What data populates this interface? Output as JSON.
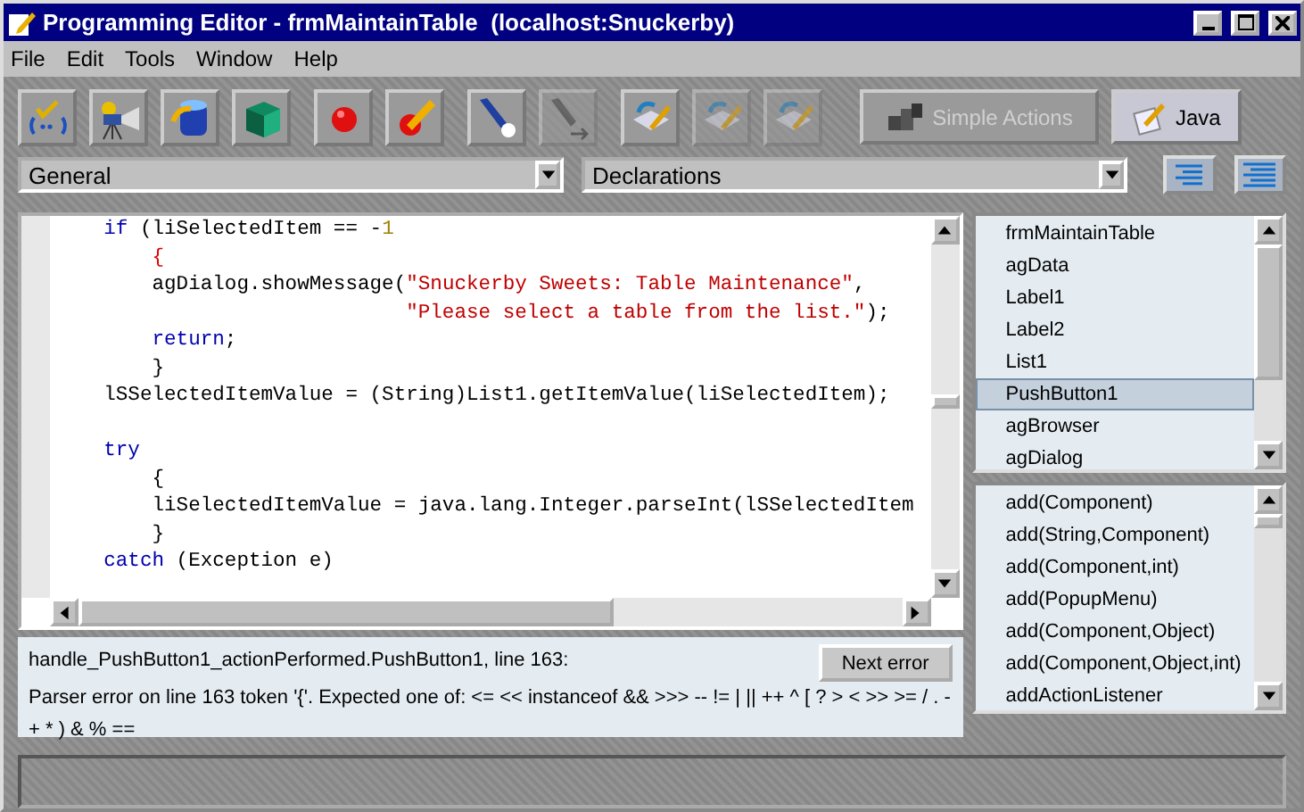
{
  "window": {
    "title": "Programming Editor - frmMaintainTable  (localhost:Snuckerby)"
  },
  "menu": [
    "File",
    "Edit",
    "Tools",
    "Window",
    "Help"
  ],
  "toolbar": [
    {
      "kind": "check",
      "disabled": false
    },
    {
      "kind": "camera",
      "disabled": false
    },
    {
      "kind": "database",
      "disabled": false
    },
    {
      "kind": "cube",
      "disabled": false
    },
    {
      "kind": "ball",
      "disabled": false
    },
    {
      "kind": "pencil-ball",
      "disabled": false
    },
    {
      "kind": "flashlight",
      "disabled": false
    },
    {
      "kind": "flashlight-arrow",
      "disabled": true
    },
    {
      "kind": "undo",
      "disabled": false
    },
    {
      "kind": "undo",
      "disabled": true
    },
    {
      "kind": "undo",
      "disabled": true
    }
  ],
  "mode_buttons": [
    {
      "label": "Simple Actions",
      "disabled": true,
      "selected": false
    },
    {
      "label": "Java",
      "disabled": false,
      "selected": true
    }
  ],
  "object_dropdown": {
    "value": "General"
  },
  "procedure_dropdown": {
    "value": "Declarations"
  },
  "view_buttons": [
    {
      "kind": "short-lines"
    },
    {
      "kind": "long-lines"
    }
  ],
  "code": [
    [
      {
        "kind": "keyword",
        "text": "    if"
      },
      {
        "kind": "plain",
        "text": " (liSelectedItem == -"
      },
      {
        "kind": "number",
        "text": "1"
      }
    ],
    [
      {
        "kind": "brace",
        "text": "        {"
      }
    ],
    [
      {
        "kind": "plain",
        "text": "        agDialog.showMessage("
      },
      {
        "kind": "string",
        "text": "\"Snuckerby Sweets: Table Maintenance\""
      },
      {
        "kind": "plain",
        "text": ","
      }
    ],
    [
      {
        "kind": "string",
        "text": "                             \"Please select a table from the list.\""
      },
      {
        "kind": "plain",
        "text": ");"
      }
    ],
    [
      {
        "kind": "keyword",
        "text": "        return"
      },
      {
        "kind": "plain",
        "text": ";"
      }
    ],
    [
      {
        "kind": "plain",
        "text": "        }"
      }
    ],
    [
      {
        "kind": "plain",
        "text": "    lSSelectedItemValue = (String)List1.getItemValue(liSelectedItem);"
      }
    ],
    [
      {
        "kind": "keyword",
        "text": "    try",
        "gap_before": true
      }
    ],
    [
      {
        "kind": "plain",
        "text": "        {"
      }
    ],
    [
      {
        "kind": "plain",
        "text": "        liSelectedItemValue = java.lang.Integer.parseInt(lSSelectedItem"
      }
    ],
    [
      {
        "kind": "plain",
        "text": "        }"
      }
    ],
    [
      {
        "kind": "keyword",
        "text": "    catch"
      },
      {
        "kind": "plain",
        "text": " (Exception e)"
      }
    ]
  ],
  "objects": [
    {
      "label": "frmMaintainTable",
      "selected": false
    },
    {
      "label": "agData",
      "selected": false
    },
    {
      "label": "Label1",
      "selected": false
    },
    {
      "label": "Label2",
      "selected": false
    },
    {
      "label": "List1",
      "selected": false
    },
    {
      "label": "PushButton1",
      "selected": true
    },
    {
      "label": "agBrowser",
      "selected": false
    },
    {
      "label": "agDialog",
      "selected": false
    }
  ],
  "methods": [
    "add(Component)",
    "add(String,Component)",
    "add(Component,int)",
    "add(PopupMenu)",
    "add(Component,Object)",
    "add(Component,Object,int)",
    "addActionListener"
  ],
  "errors": {
    "location": "handle_PushButton1_actionPerformed.PushButton1, line 163:",
    "message": "Parser error on line 163 token '{'.  Expected one of: <= << instanceof && >>> -- != | || ++ ^ [ ? > < >> >= / . - + * ) & % ==",
    "next_button": "Next error"
  }
}
